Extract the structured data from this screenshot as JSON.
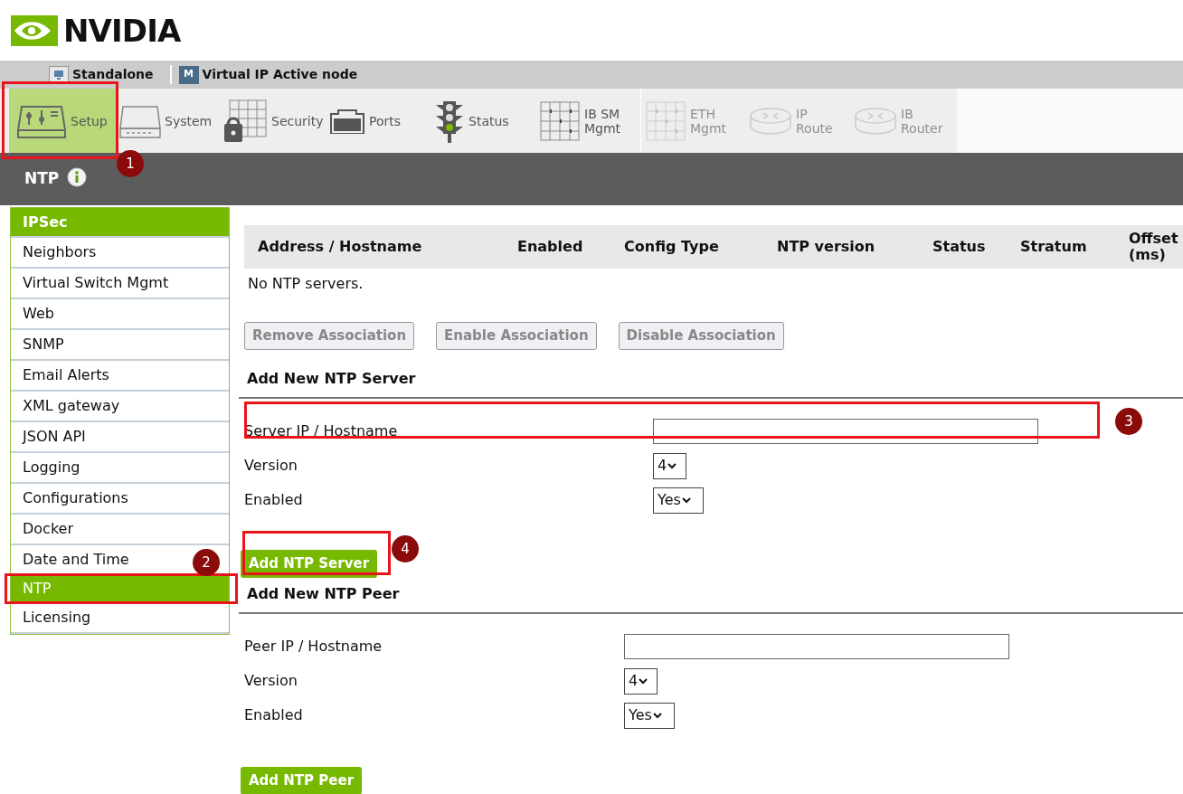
{
  "logo": {
    "text": "NVIDIA"
  },
  "node_bar": [
    {
      "label": "Standalone"
    },
    {
      "label": "Virtual IP Active node",
      "badge": "M"
    }
  ],
  "toolbar": [
    {
      "label": "Setup",
      "selected": true,
      "disabled": false
    },
    {
      "label": "System",
      "selected": false,
      "disabled": false
    },
    {
      "label": "Security",
      "selected": false,
      "disabled": false
    },
    {
      "label": "Ports",
      "selected": false,
      "disabled": false
    },
    {
      "label": "Status",
      "selected": false,
      "disabled": false
    },
    {
      "label": "IB SM\nMgmt",
      "selected": false,
      "disabled": false
    },
    {
      "label": "ETH\nMgmt",
      "selected": false,
      "disabled": true
    },
    {
      "label": "IP\nRoute",
      "selected": false,
      "disabled": true
    },
    {
      "label": "IB\nRouter",
      "selected": false,
      "disabled": true
    }
  ],
  "page_title": "NTP",
  "sidebar": {
    "items": [
      {
        "label": "IPSec",
        "kind": "header"
      },
      {
        "label": "Neighbors",
        "selected": false,
        "kind": "item"
      },
      {
        "label": "Virtual Switch Mgmt",
        "selected": false,
        "kind": "item"
      },
      {
        "label": "Web",
        "selected": false,
        "kind": "item"
      },
      {
        "label": "SNMP",
        "selected": false,
        "kind": "item"
      },
      {
        "label": "Email Alerts",
        "selected": false,
        "kind": "item"
      },
      {
        "label": "XML gateway",
        "selected": false,
        "kind": "item"
      },
      {
        "label": "JSON API",
        "selected": false,
        "kind": "item"
      },
      {
        "label": "Logging",
        "selected": false,
        "kind": "item"
      },
      {
        "label": "Configurations",
        "selected": false,
        "kind": "item"
      },
      {
        "label": "Docker",
        "selected": false,
        "kind": "item"
      },
      {
        "label": "Date and Time",
        "selected": false,
        "kind": "item"
      },
      {
        "label": "NTP",
        "selected": true,
        "kind": "item"
      },
      {
        "label": "Licensing",
        "selected": false,
        "kind": "item"
      }
    ]
  },
  "table": {
    "columns": [
      "Address / Hostname",
      "Enabled",
      "Config Type",
      "NTP version",
      "Status",
      "Stratum",
      "Offset\n(ms)"
    ],
    "empty_text": "No NTP servers."
  },
  "association_buttons": [
    {
      "label": "Remove Association",
      "disabled": true
    },
    {
      "label": "Enable Association",
      "disabled": true
    },
    {
      "label": "Disable Association",
      "disabled": true
    }
  ],
  "sections": [
    {
      "title": "Add New NTP Server",
      "host_label": "Server IP / Hostname",
      "version_label": "Version",
      "version": "4",
      "enabled_label": "Enabled",
      "enabled": "Yes",
      "button": "Add NTP Server"
    },
    {
      "title": "Add New NTP Peer",
      "host_label": "Peer IP / Hostname",
      "version_label": "Version",
      "version": "4",
      "enabled_label": "Enabled",
      "enabled": "Yes",
      "button": "Add NTP Peer"
    }
  ],
  "callouts": [
    {
      "number": "1"
    },
    {
      "number": "2"
    },
    {
      "number": "3"
    },
    {
      "number": "4"
    }
  ]
}
